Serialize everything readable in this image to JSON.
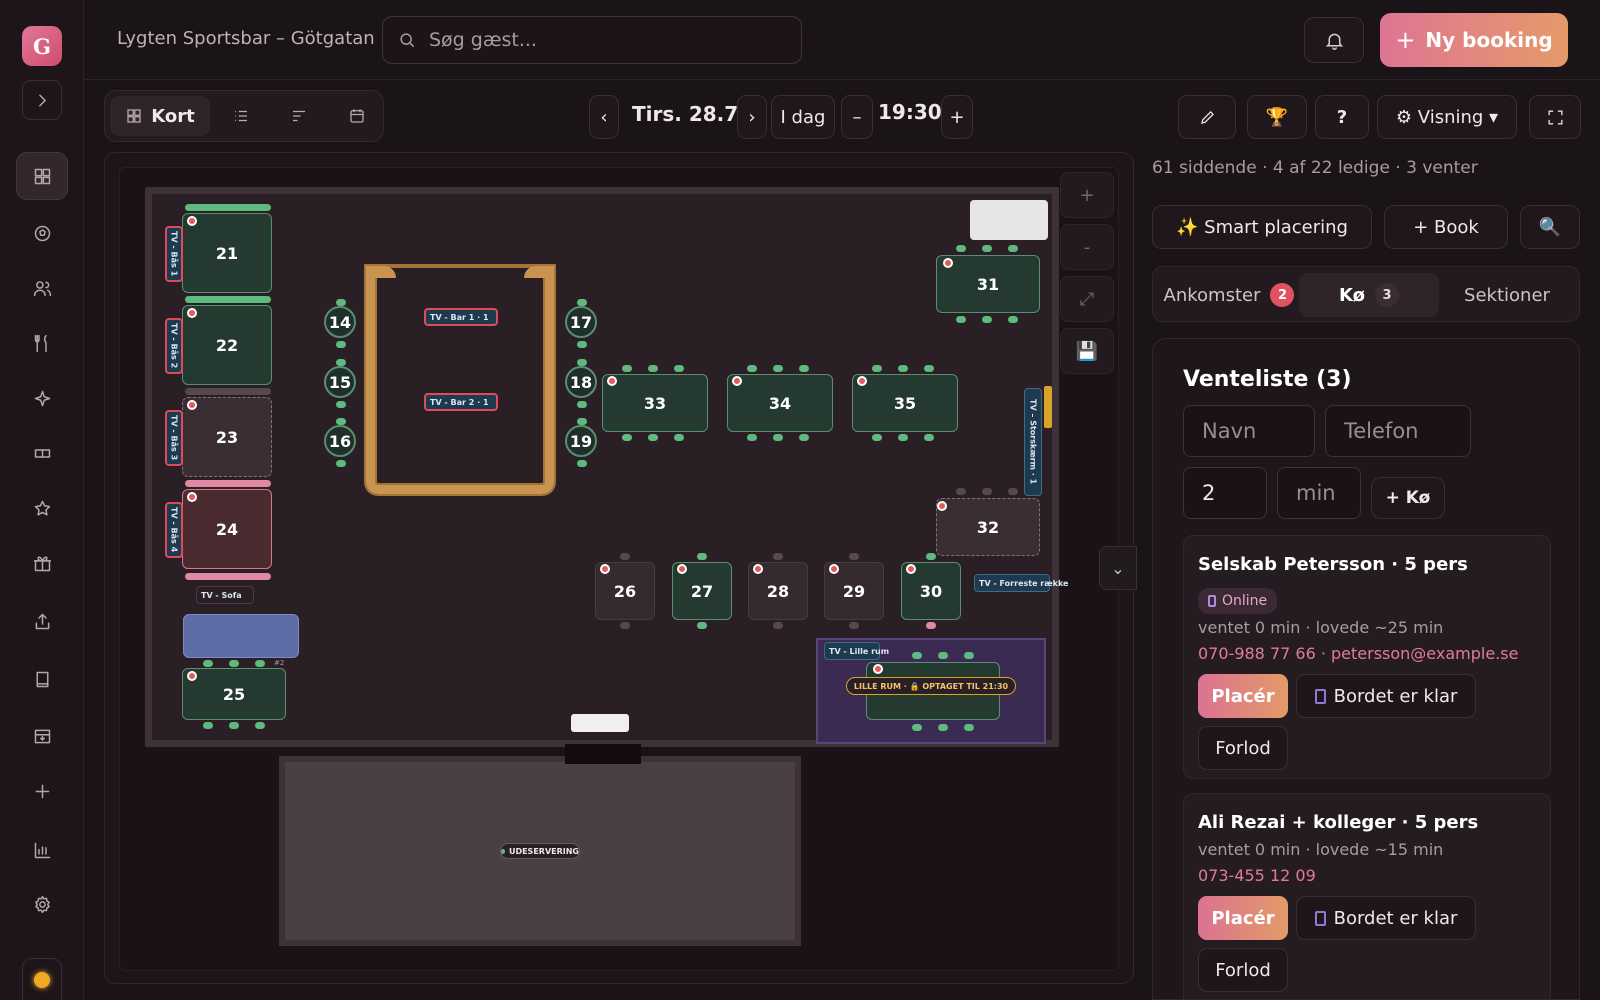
{
  "app": {
    "logo_letter": "G",
    "venue": "Lygten Sportsbar – Götgatan"
  },
  "search": {
    "placeholder": "Søg gæst..."
  },
  "header": {
    "new_booking": "Ny booking"
  },
  "toolbar": {
    "view_map": "Kort",
    "prev": "‹",
    "next": "›",
    "date": "Tirs. 28.7",
    "today": "I dag",
    "minus": "–",
    "plus": "+",
    "time": "19:30",
    "help": "?",
    "visning": "⚙ Visning ▾"
  },
  "map": {
    "zoom_in": "+",
    "zoom_out": "-",
    "tables": [
      {
        "id": "21"
      },
      {
        "id": "22"
      },
      {
        "id": "23"
      },
      {
        "id": "24"
      },
      {
        "id": "25"
      },
      {
        "id": "14"
      },
      {
        "id": "15"
      },
      {
        "id": "16"
      },
      {
        "id": "17"
      },
      {
        "id": "18"
      },
      {
        "id": "19"
      },
      {
        "id": "31"
      },
      {
        "id": "32"
      },
      {
        "id": "33"
      },
      {
        "id": "34"
      },
      {
        "id": "35"
      },
      {
        "id": "26"
      },
      {
        "id": "27"
      },
      {
        "id": "28"
      },
      {
        "id": "29"
      },
      {
        "id": "30"
      }
    ],
    "tv_bar1": "TV - Bar 1 · 1",
    "tv_bar2": "TV - Bar 2 · 1",
    "tv_bas1": "TV - Bås 1",
    "tv_bas2": "TV - Bås 2",
    "tv_bas3": "TV - Bås 3",
    "tv_bas4": "TV - Bås 4",
    "tv_sofa": "TV - Sofa",
    "tv_stor": "TV – Storskærm · 1",
    "tv_forreste": "TV - Forreste række",
    "tv_lille": "TV - Lille rum",
    "lille_status": "LILLE RUM · 🔒 OPTAGET TIL 21:30",
    "outdoor": "UDESERVERING",
    "marker_2": "#2"
  },
  "panel": {
    "stats": "61 siddende · 4 af 22 ledige · 3 venter",
    "smart": "✨ Smart placering",
    "book": "+ Book",
    "search_icon": "🔍",
    "tab_arrivals": "Ankomster",
    "arrivals_count": "2",
    "tab_queue": "Kø",
    "queue_count": "3",
    "tab_sections": "Sektioner"
  },
  "waitlist": {
    "title": "Venteliste (3)",
    "name_placeholder": "Navn",
    "phone_placeholder": "Telefon",
    "party_value": "2",
    "min_placeholder": "min",
    "add_button": "+ Kø",
    "entries": [
      {
        "title": "Selskab Petersson · 5 pers",
        "badge": "Online",
        "wait": "ventet 0 min · lovede ~25 min",
        "contact": "070-988 77 66 · petersson@example.se"
      },
      {
        "title": "Ali Rezai + kolleger · 5 pers",
        "wait": "ventet 0 min · lovede ~15 min",
        "contact": "073-455 12 09"
      }
    ],
    "place_label": "Placér",
    "ready_label": "Bordet er klar",
    "leave_label": "Forlod"
  },
  "colors": {
    "accent": "#de7593",
    "accent2": "#e59a6a",
    "table_green": "#5fba7d",
    "bg": "#1a1317"
  }
}
